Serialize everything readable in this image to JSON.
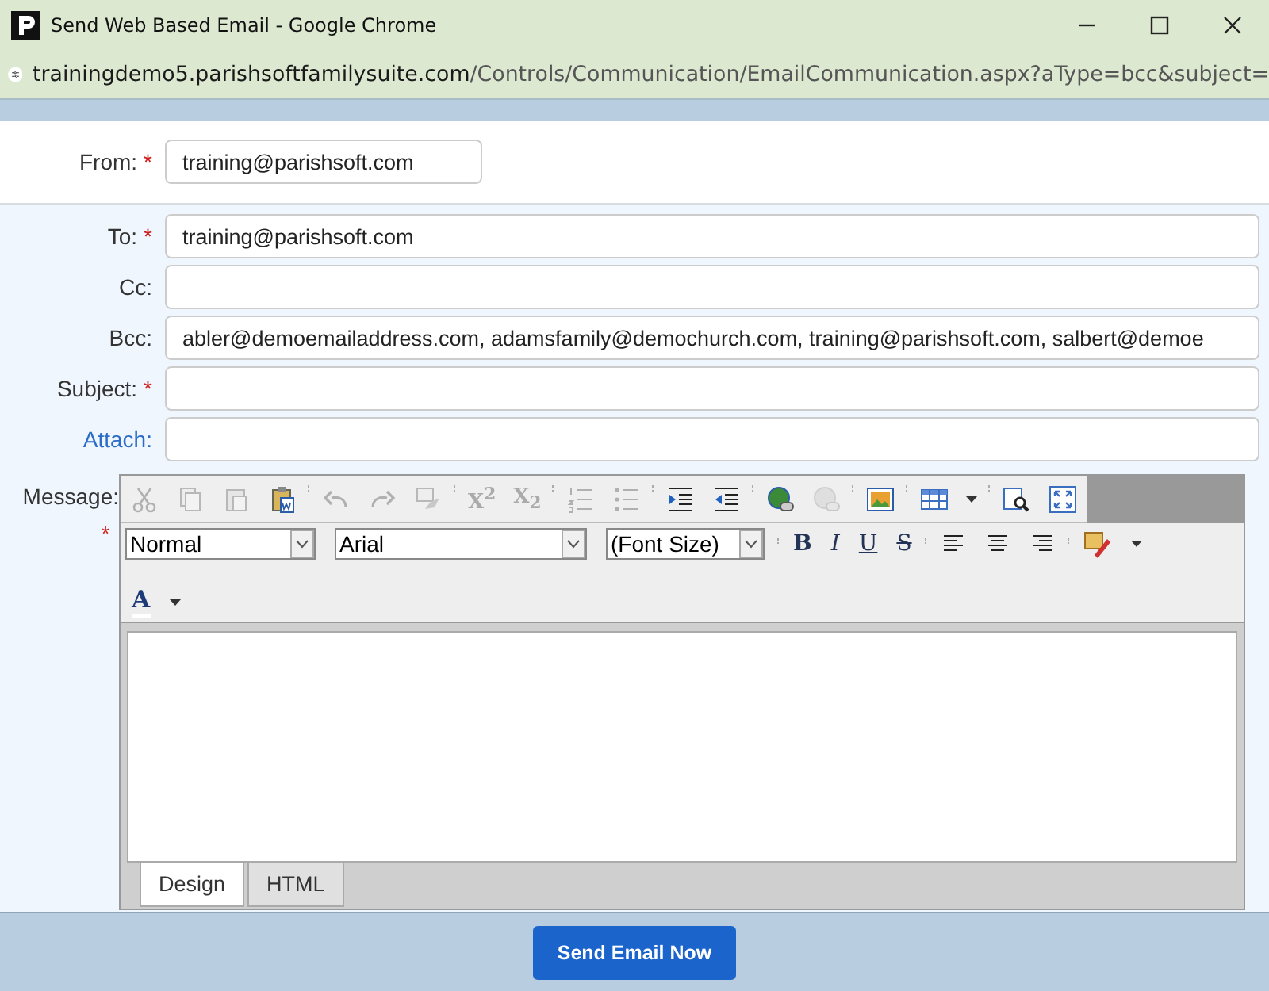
{
  "window": {
    "title": "Send Web Based Email - Google Chrome"
  },
  "address_bar": {
    "host": "trainingdemo5.parishsoftfamilysuite.com",
    "path": "/Controls/Communication/EmailCommunication.aspx?aType=bcc&subject="
  },
  "from": {
    "label": "From:",
    "required_mark": "*",
    "value": "training@parishsoft.com"
  },
  "fields": [
    {
      "label": "To:",
      "required_mark": "*",
      "kind": "text",
      "value": "training@parishsoft.com"
    },
    {
      "label": "Cc:",
      "kind": "text"
    },
    {
      "label": "Bcc:",
      "kind": "text",
      "value": "abler@demoemailaddress.com, adamsfamily@demochurch.com, training@parishsoft.com, salbert@demoe"
    },
    {
      "label": "Subject:",
      "required_mark": "*",
      "kind": "text"
    },
    {
      "label": "Attach:",
      "kind": "link"
    }
  ],
  "message": {
    "label": "Message:",
    "required_mark": "*"
  },
  "toolbar": [
    {
      "kind": "icon",
      "disabled": true
    },
    {
      "kind": "icon",
      "disabled": true
    },
    {
      "kind": "icon",
      "disabled": true
    },
    {
      "kind": "icon",
      "disabled": false
    },
    {
      "kind": "icon",
      "disabled": true
    },
    {
      "kind": "icon",
      "disabled": true
    },
    {
      "kind": "icon",
      "disabled": true
    },
    {
      "kind": "text",
      "label": "X$^{2}$",
      "disabled": true
    },
    {
      "kind": "text",
      "label": "X$_{2}$",
      "disabled": true
    },
    {
      "kind": "icon",
      "disabled": true
    },
    {
      "kind": "icon",
      "disabled": true
    },
    {
      "kind": "icon",
      "disabled": false
    },
    {
      "kind": "icon",
      "disabled": false
    },
    {
      "kind": "icon",
      "disabled": false
    },
    {
      "kind": "icon",
      "disabled": true
    },
    {
      "kind": "icon",
      "disabled": false
    },
    {
      "kind": "icon",
      "disabled": false
    },
    {
      "kind": "icon",
      "disabled": false
    },
    {
      "kind": "icon",
      "disabled": false
    }
  ],
  "dropdowns": [
    {
      "value": "Normal"
    },
    {
      "value": "Arial"
    },
    {
      "value": "(Font Size)"
    }
  ],
  "format_buttons": [
    {
      "label": "B"
    },
    {
      "label": "I"
    },
    {
      "label": "U"
    },
    {
      "label": "S"
    }
  ],
  "font_color": {
    "label": "A"
  },
  "editor_tabs": [
    {
      "label": "Design",
      "selected": true
    },
    {
      "label": "HTML",
      "selected": false
    }
  ],
  "send_button": "Send Email Now"
}
